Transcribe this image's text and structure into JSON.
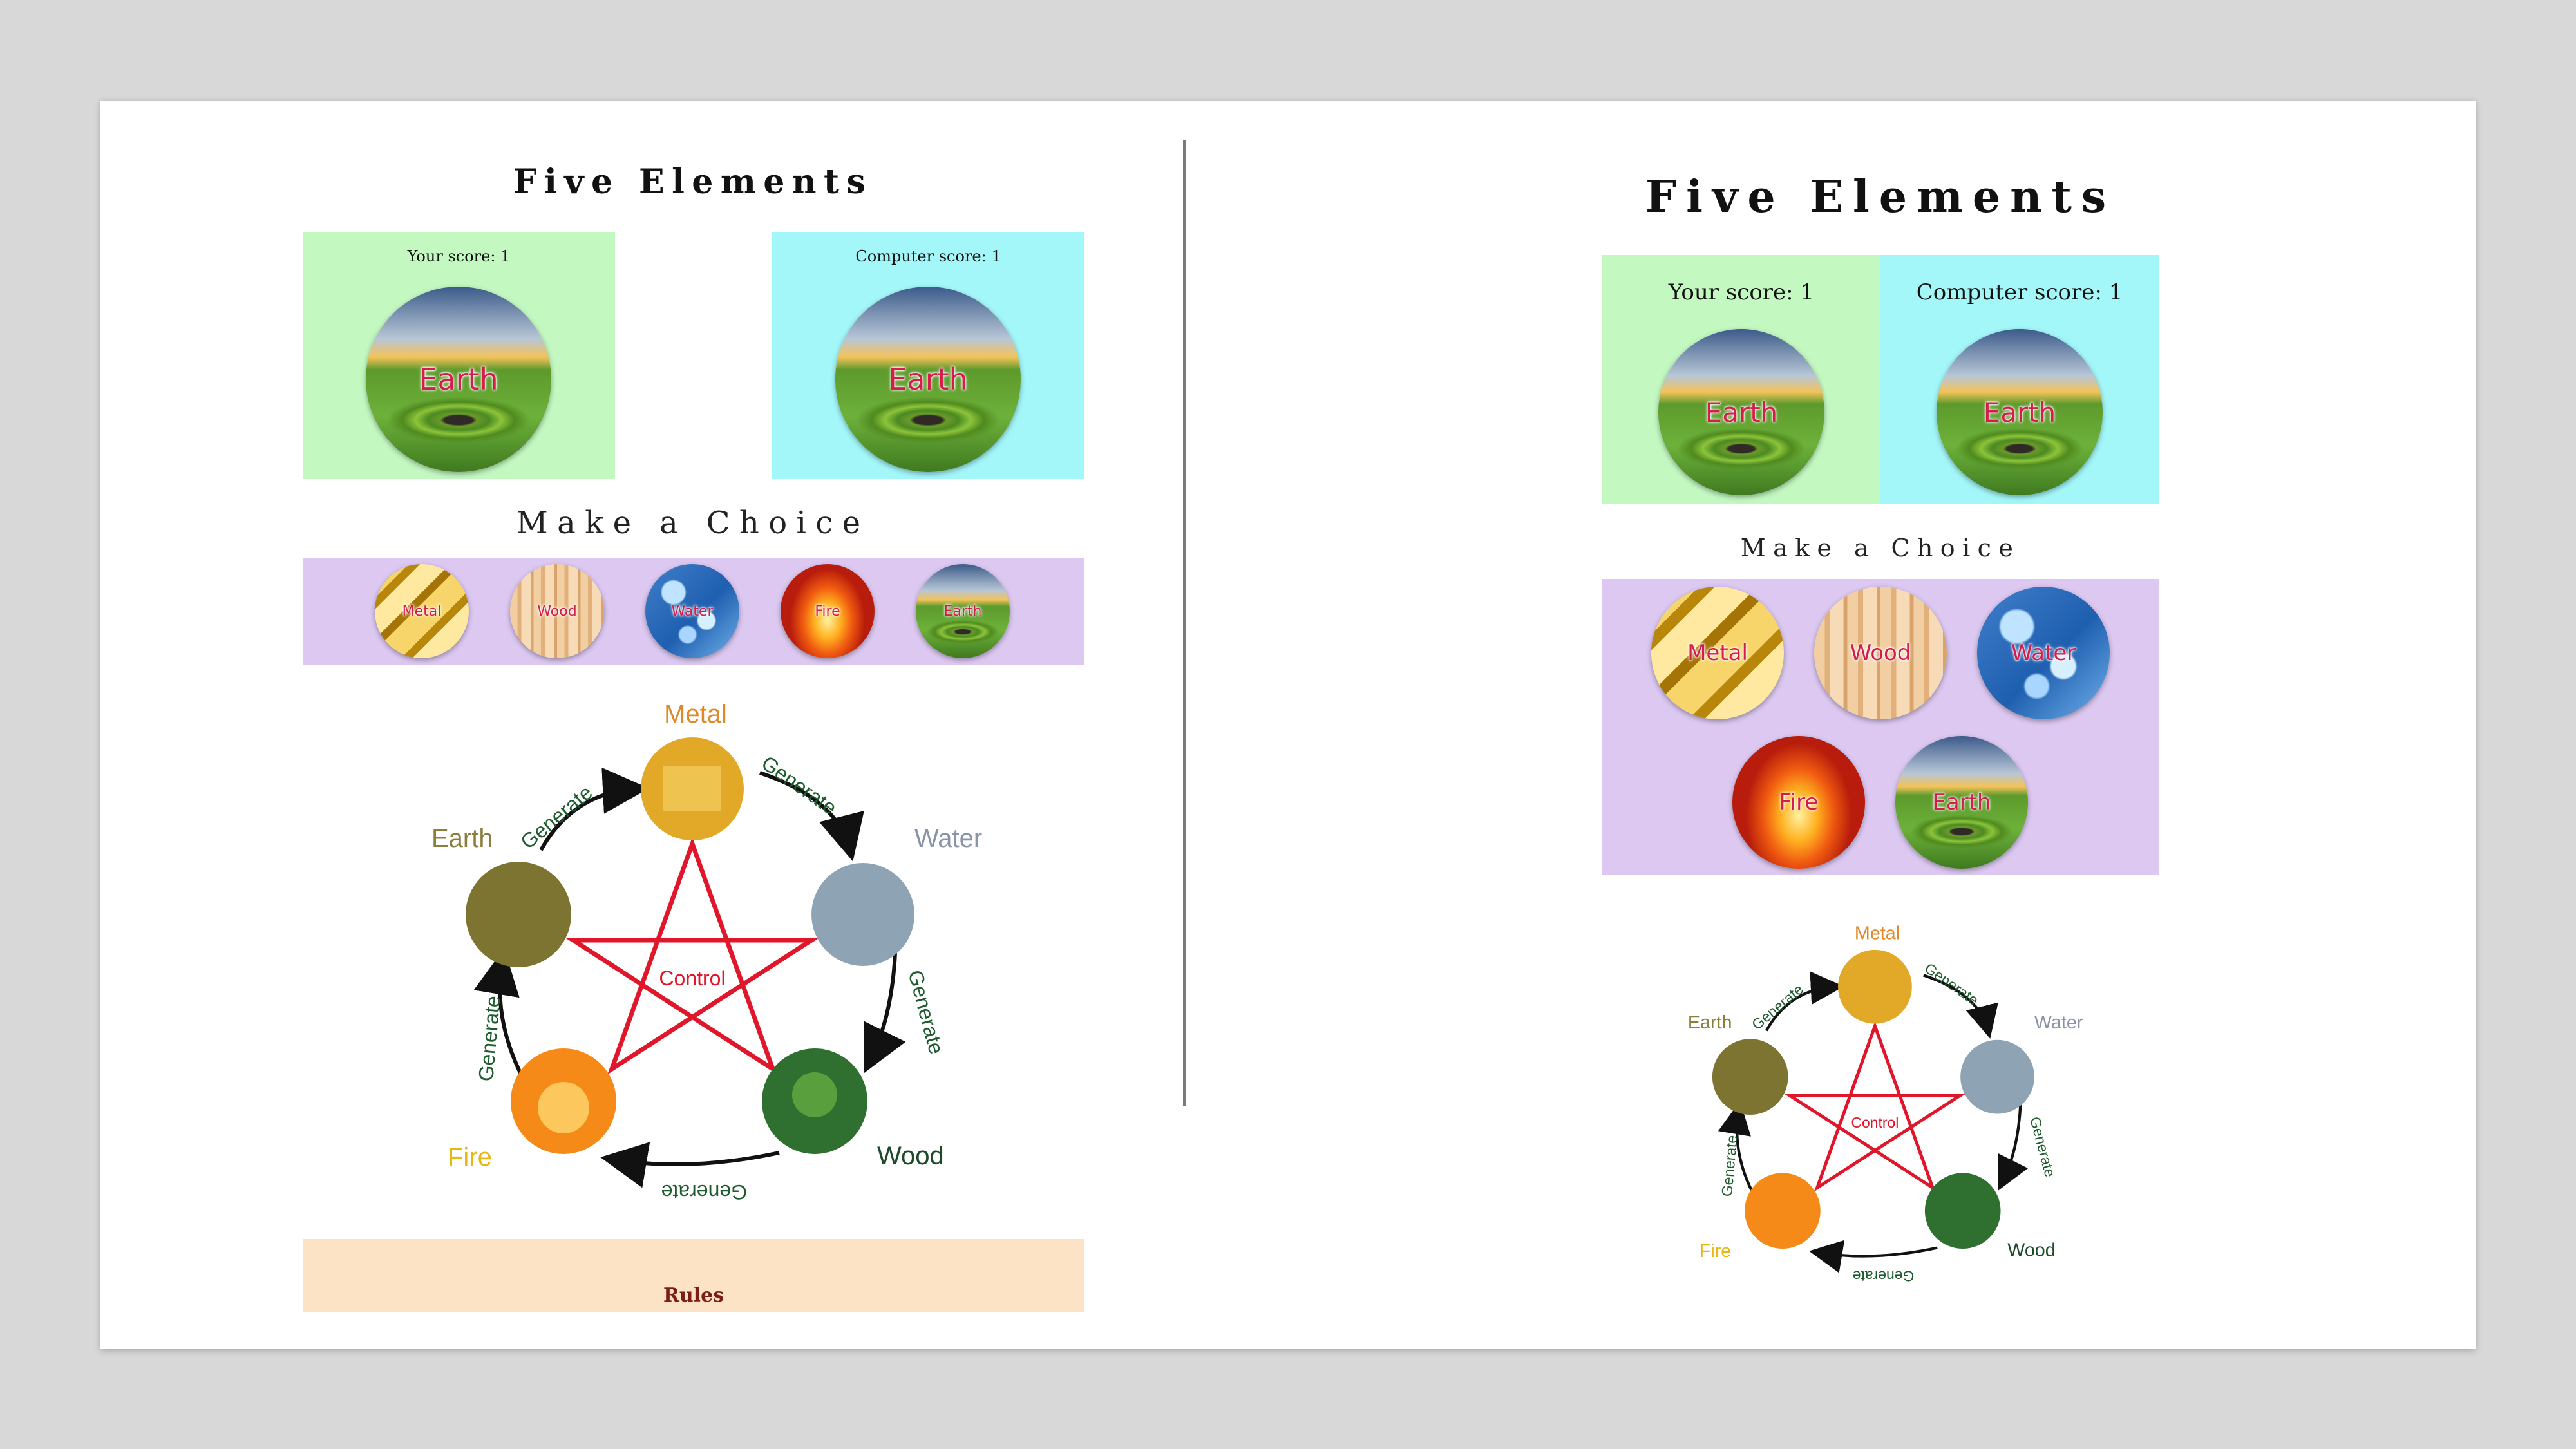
{
  "left": {
    "title": "Five Elements",
    "your_score": "Your score: 1",
    "computer_score": "Computer score: 1",
    "player_choice": "Earth",
    "computer_choice": "Earth",
    "choice_heading": "Make a Choice",
    "choices": [
      "Metal",
      "Wood",
      "Water",
      "Fire",
      "Earth"
    ],
    "rules_label": "Rules"
  },
  "right": {
    "title": "Five Elements",
    "your_score": "Your score: 1",
    "computer_score": "Computer score: 1",
    "player_choice": "Earth",
    "computer_choice": "Earth",
    "choice_heading": "Make a Choice",
    "choices": [
      "Metal",
      "Wood",
      "Water",
      "Fire",
      "Earth"
    ]
  },
  "diagram": {
    "elements": [
      "Metal",
      "Water",
      "Wood",
      "Fire",
      "Earth"
    ],
    "cycle_label": "Generate",
    "center_label": "Control"
  },
  "colors": {
    "player_panel": "#c3f8c1",
    "computer_panel": "#a3f7f9",
    "choice_bar": "#dcc8f1",
    "rules_bar": "#fde3c6",
    "choice_text": "#d41d4a",
    "generate_text": "#1e5b2e",
    "control_line": "#e0162b"
  }
}
